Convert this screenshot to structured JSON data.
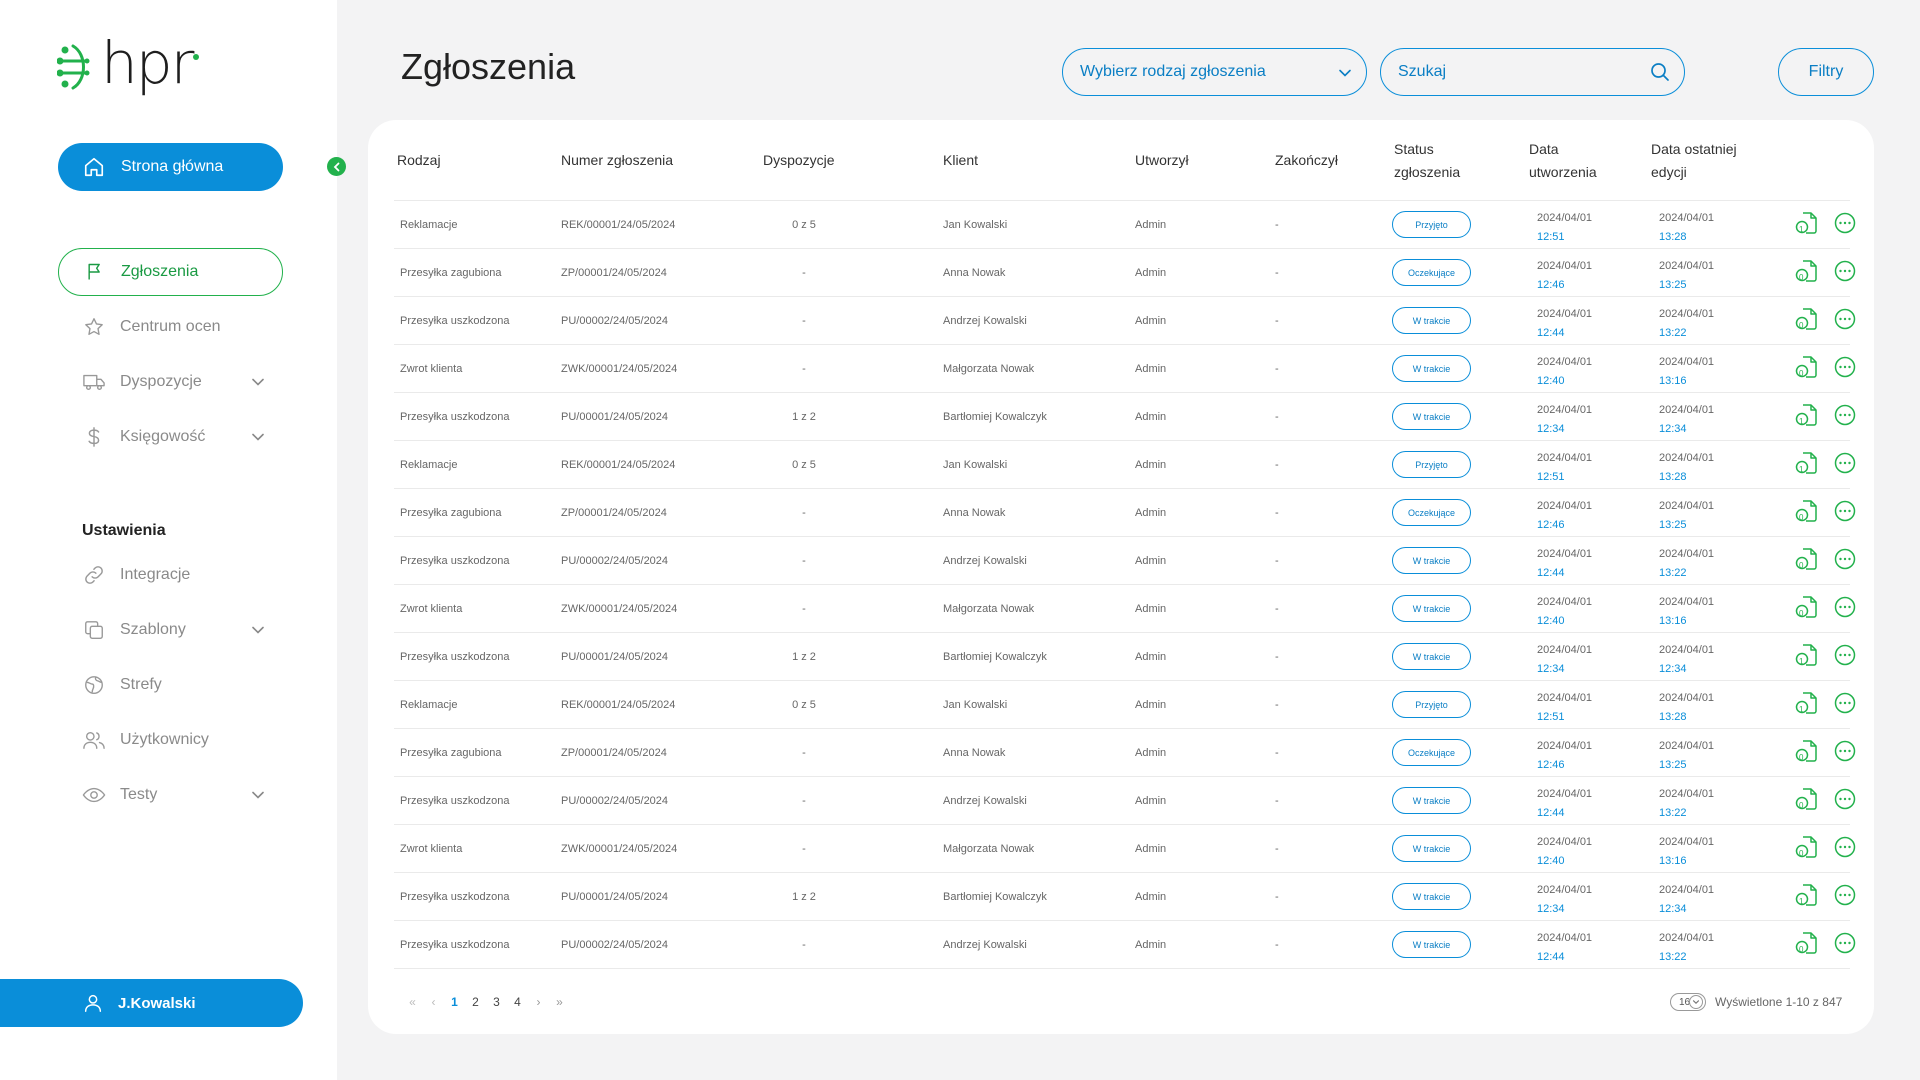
{
  "brand": {
    "name": "hpr",
    "accent": "#0a8ed9",
    "green": "#22b14c"
  },
  "sidebar": {
    "home_label": "Strona główna",
    "items": [
      {
        "label": "Zgłoszenia",
        "icon": "flag-icon",
        "active": true,
        "expandable": false
      },
      {
        "label": "Centrum ocen",
        "icon": "star-icon",
        "active": false,
        "expandable": false
      },
      {
        "label": "Dyspozycje",
        "icon": "truck-icon",
        "active": false,
        "expandable": true
      },
      {
        "label": "Księgowość",
        "icon": "dollar-icon",
        "active": false,
        "expandable": true
      }
    ],
    "settings_title": "Ustawienia",
    "settings_items": [
      {
        "label": "Integracje",
        "icon": "link-icon",
        "expandable": false
      },
      {
        "label": "Szablony",
        "icon": "copy-icon",
        "expandable": true
      },
      {
        "label": "Strefy",
        "icon": "globe-icon",
        "expandable": false
      },
      {
        "label": "Użytkownicy",
        "icon": "users-icon",
        "expandable": false
      },
      {
        "label": "Testy",
        "icon": "eye-icon",
        "expandable": true
      }
    ],
    "user_label": "J.Kowalski"
  },
  "header": {
    "title": "Zgłoszenia",
    "type_select_label": "Wybierz rodzaj zgłoszenia",
    "search_placeholder": "Szukaj",
    "filters_label": "Filtry"
  },
  "table": {
    "columns": [
      {
        "label": "Rodzaj"
      },
      {
        "label": "Numer zgłoszenia"
      },
      {
        "label": "Dyspozycje"
      },
      {
        "label": "Klient"
      },
      {
        "label": "Utworzył"
      },
      {
        "label": "Zakończył"
      },
      {
        "label": "Status zgłoszenia"
      },
      {
        "label": "Data utworzenia"
      },
      {
        "label": "Data ostatniej edycji"
      }
    ],
    "rows": [
      {
        "type": "Reklamacje",
        "number": "REK/00001/24/05/2024",
        "disp": "0 z 5",
        "client": "Jan Kowalski",
        "created_by": "Admin",
        "finished_by": "-",
        "status": "Przyjęto",
        "created_date": "2024/04/01",
        "created_time": "12:51",
        "edited_date": "2024/04/01",
        "edited_time": "13:28",
        "doc_badge": "1"
      },
      {
        "type": "Przesyłka zagubiona",
        "number": "ZP/00001/24/05/2024",
        "disp": "-",
        "client": "Anna Nowak",
        "created_by": "Admin",
        "finished_by": "-",
        "status": "Oczekujące",
        "created_date": "2024/04/01",
        "created_time": "12:46",
        "edited_date": "2024/04/01",
        "edited_time": "13:25",
        "doc_badge": "0"
      },
      {
        "type": "Przesyłka uszkodzona",
        "number": "PU/00002/24/05/2024",
        "disp": "-",
        "client": "Andrzej Kowalski",
        "created_by": "Admin",
        "finished_by": "-",
        "status": "W trakcie",
        "created_date": "2024/04/01",
        "created_time": "12:44",
        "edited_date": "2024/04/01",
        "edited_time": "13:22",
        "doc_badge": "0"
      },
      {
        "type": "Zwrot klienta",
        "number": "ZWK/00001/24/05/2024",
        "disp": "-",
        "client": "Małgorzata Nowak",
        "created_by": "Admin",
        "finished_by": "-",
        "status": "W trakcie",
        "created_date": "2024/04/01",
        "created_time": "12:40",
        "edited_date": "2024/04/01",
        "edited_time": "13:16",
        "doc_badge": "0"
      },
      {
        "type": "Przesyłka uszkodzona",
        "number": "PU/00001/24/05/2024",
        "disp": "1 z 2",
        "client": "Bartłomiej Kowalczyk",
        "created_by": "Admin",
        "finished_by": "-",
        "status": "W trakcie",
        "created_date": "2024/04/01",
        "created_time": "12:34",
        "edited_date": "2024/04/01",
        "edited_time": "12:34",
        "doc_badge": "1"
      },
      {
        "type": "Reklamacje",
        "number": "REK/00001/24/05/2024",
        "disp": "0 z 5",
        "client": "Jan Kowalski",
        "created_by": "Admin",
        "finished_by": "-",
        "status": "Przyjęto",
        "created_date": "2024/04/01",
        "created_time": "12:51",
        "edited_date": "2024/04/01",
        "edited_time": "13:28",
        "doc_badge": "1"
      },
      {
        "type": "Przesyłka zagubiona",
        "number": "ZP/00001/24/05/2024",
        "disp": "-",
        "client": "Anna Nowak",
        "created_by": "Admin",
        "finished_by": "-",
        "status": "Oczekujące",
        "created_date": "2024/04/01",
        "created_time": "12:46",
        "edited_date": "2024/04/01",
        "edited_time": "13:25",
        "doc_badge": "0"
      },
      {
        "type": "Przesyłka uszkodzona",
        "number": "PU/00002/24/05/2024",
        "disp": "-",
        "client": "Andrzej Kowalski",
        "created_by": "Admin",
        "finished_by": "-",
        "status": "W trakcie",
        "created_date": "2024/04/01",
        "created_time": "12:44",
        "edited_date": "2024/04/01",
        "edited_time": "13:22",
        "doc_badge": "0"
      },
      {
        "type": "Zwrot klienta",
        "number": "ZWK/00001/24/05/2024",
        "disp": "-",
        "client": "Małgorzata Nowak",
        "created_by": "Admin",
        "finished_by": "-",
        "status": "W trakcie",
        "created_date": "2024/04/01",
        "created_time": "12:40",
        "edited_date": "2024/04/01",
        "edited_time": "13:16",
        "doc_badge": "0"
      },
      {
        "type": "Przesyłka uszkodzona",
        "number": "PU/00001/24/05/2024",
        "disp": "1 z 2",
        "client": "Bartłomiej Kowalczyk",
        "created_by": "Admin",
        "finished_by": "-",
        "status": "W trakcie",
        "created_date": "2024/04/01",
        "created_time": "12:34",
        "edited_date": "2024/04/01",
        "edited_time": "12:34",
        "doc_badge": "1"
      },
      {
        "type": "Reklamacje",
        "number": "REK/00001/24/05/2024",
        "disp": "0 z 5",
        "client": "Jan Kowalski",
        "created_by": "Admin",
        "finished_by": "-",
        "status": "Przyjęto",
        "created_date": "2024/04/01",
        "created_time": "12:51",
        "edited_date": "2024/04/01",
        "edited_time": "13:28",
        "doc_badge": "1"
      },
      {
        "type": "Przesyłka zagubiona",
        "number": "ZP/00001/24/05/2024",
        "disp": "-",
        "client": "Anna Nowak",
        "created_by": "Admin",
        "finished_by": "-",
        "status": "Oczekujące",
        "created_date": "2024/04/01",
        "created_time": "12:46",
        "edited_date": "2024/04/01",
        "edited_time": "13:25",
        "doc_badge": "0"
      },
      {
        "type": "Przesyłka uszkodzona",
        "number": "PU/00002/24/05/2024",
        "disp": "-",
        "client": "Andrzej Kowalski",
        "created_by": "Admin",
        "finished_by": "-",
        "status": "W trakcie",
        "created_date": "2024/04/01",
        "created_time": "12:44",
        "edited_date": "2024/04/01",
        "edited_time": "13:22",
        "doc_badge": "0"
      },
      {
        "type": "Zwrot klienta",
        "number": "ZWK/00001/24/05/2024",
        "disp": "-",
        "client": "Małgorzata Nowak",
        "created_by": "Admin",
        "finished_by": "-",
        "status": "W trakcie",
        "created_date": "2024/04/01",
        "created_time": "12:40",
        "edited_date": "2024/04/01",
        "edited_time": "13:16",
        "doc_badge": "0"
      },
      {
        "type": "Przesyłka uszkodzona",
        "number": "PU/00001/24/05/2024",
        "disp": "1 z 2",
        "client": "Bartłomiej Kowalczyk",
        "created_by": "Admin",
        "finished_by": "-",
        "status": "W trakcie",
        "created_date": "2024/04/01",
        "created_time": "12:34",
        "edited_date": "2024/04/01",
        "edited_time": "12:34",
        "doc_badge": "1"
      },
      {
        "type": "Przesyłka uszkodzona",
        "number": "PU/00002/24/05/2024",
        "disp": "-",
        "client": "Andrzej Kowalski",
        "created_by": "Admin",
        "finished_by": "-",
        "status": "W trakcie",
        "created_date": "2024/04/01",
        "created_time": "12:44",
        "edited_date": "2024/04/01",
        "edited_time": "13:22",
        "doc_badge": "0"
      }
    ]
  },
  "pagination": {
    "pages": [
      "1",
      "2",
      "3",
      "4"
    ],
    "current": "1",
    "page_size": "16",
    "shown_text": "Wyświetlone 1-10 z 847"
  }
}
